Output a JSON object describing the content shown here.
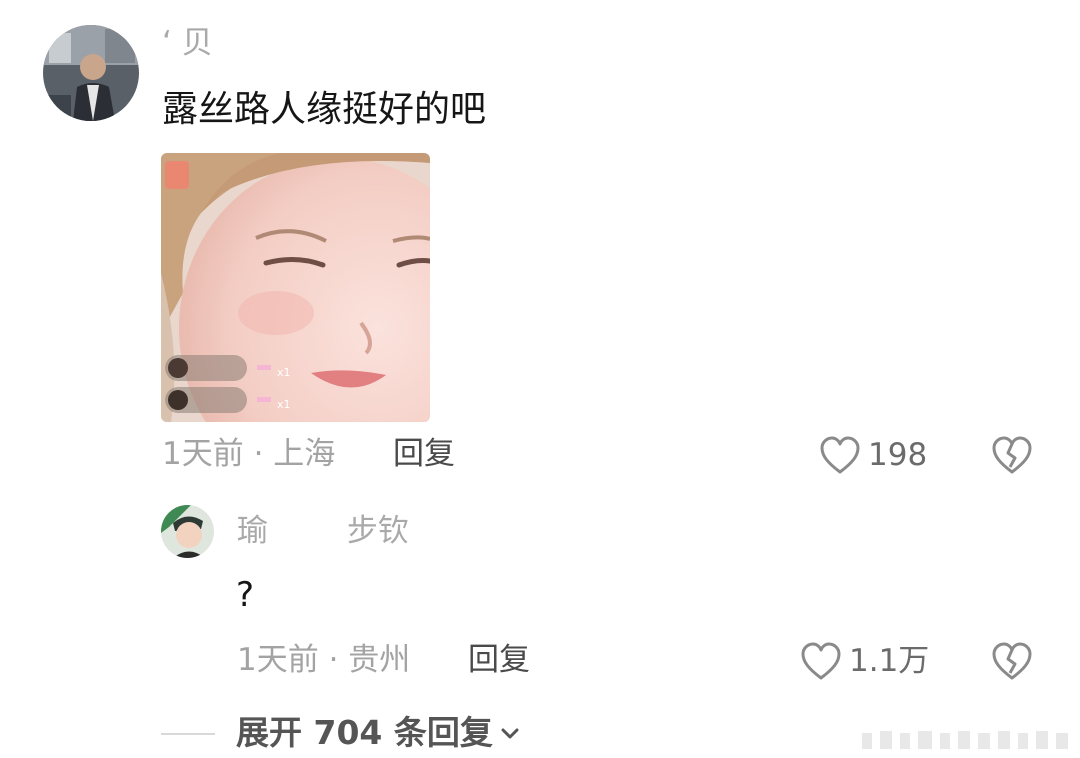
{
  "comments": [
    {
      "username": "‘ 贝",
      "text": "露丝路人缘挺好的吧",
      "time_location": "1天前 · 上海",
      "reply_label": "回复",
      "like_count": "198",
      "has_image": true
    },
    {
      "username": "瑜        步钦",
      "text": "?",
      "time_location": "1天前 · 贵州",
      "reply_label": "回复",
      "like_count": "1.1万",
      "has_image": false
    }
  ],
  "expand_replies_label": "展开 704 条回复",
  "icons": {
    "like": "heart-outline-icon",
    "dislike": "broken-heart-icon",
    "expand": "chevron-down-icon"
  },
  "colors": {
    "meta_text": "#a3a3a3",
    "icon_stroke": "#8a8a8a",
    "expand_text": "#555555"
  }
}
